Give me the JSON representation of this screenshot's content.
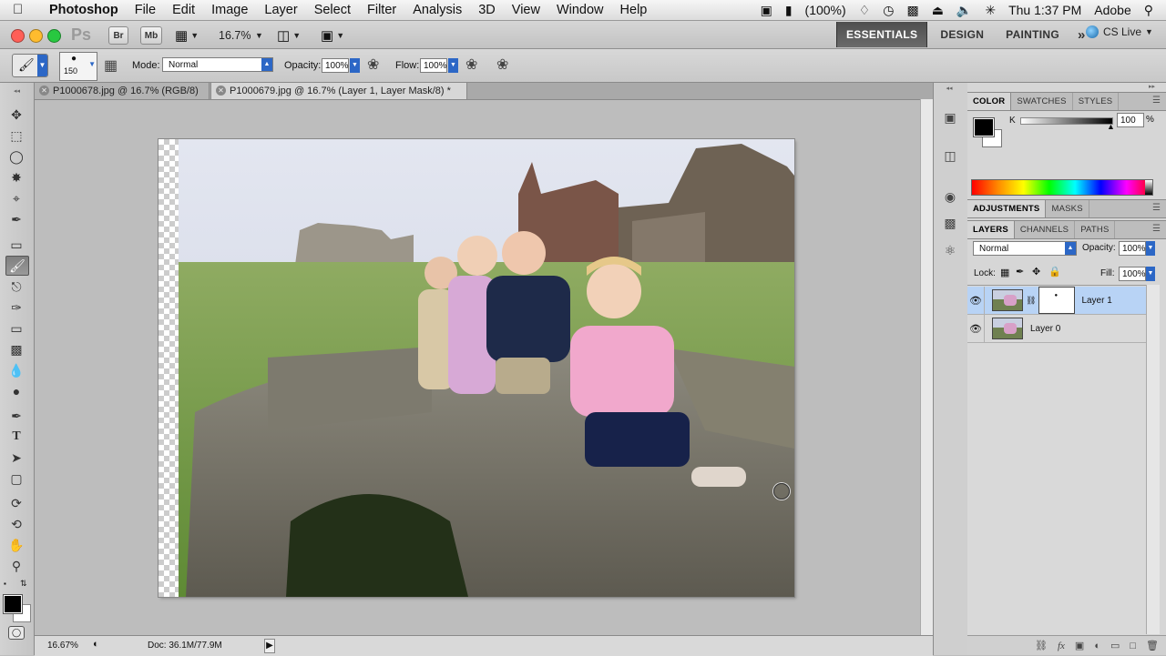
{
  "menubar": {
    "apple": "",
    "items": [
      "Photoshop",
      "File",
      "Edit",
      "Image",
      "Layer",
      "Select",
      "Filter",
      "Analysis",
      "3D",
      "View",
      "Window",
      "Help"
    ],
    "battery": "(100%)",
    "clock": "Thu 1:37 PM",
    "user": "Adobe"
  },
  "appbar": {
    "logo": "Ps",
    "bridge": "Br",
    "minibridge": "Mb",
    "zoom": "16.7%",
    "workspaces": [
      "ESSENTIALS",
      "DESIGN",
      "PAINTING"
    ],
    "more": "»",
    "cslive": "CS Live"
  },
  "options": {
    "brush_size": "150",
    "mode_label": "Mode:",
    "mode_value": "Normal",
    "opacity_label": "Opacity:",
    "opacity_value": "100%",
    "flow_label": "Flow:",
    "flow_value": "100%"
  },
  "tabs": [
    {
      "label": "P1000678.jpg @ 16.7% (RGB/8)"
    },
    {
      "label": "P1000679.jpg @ 16.7% (Layer 1, Layer Mask/8) *"
    }
  ],
  "status": {
    "zoom": "16.67%",
    "doc": "Doc: 36.1M/77.9M"
  },
  "color_panel": {
    "tabs": [
      "COLOR",
      "SWATCHES",
      "STYLES"
    ],
    "channel": "K",
    "value": "100",
    "unit": "%"
  },
  "adjust_panel": {
    "tabs": [
      "ADJUSTMENTS",
      "MASKS"
    ]
  },
  "layers_panel": {
    "tabs": [
      "LAYERS",
      "CHANNELS",
      "PATHS"
    ],
    "blend_mode": "Normal",
    "opacity_label": "Opacity:",
    "opacity_value": "100%",
    "lock_label": "Lock:",
    "fill_label": "Fill:",
    "fill_value": "100%",
    "layers": [
      {
        "name": "Layer 1",
        "selected": true,
        "has_mask": true
      },
      {
        "name": "Layer 0",
        "selected": false,
        "has_mask": false
      }
    ]
  },
  "colors": {
    "accent_blue": "#2c67c6",
    "selected_row": "#b8d3f5",
    "foreground": "#000000",
    "background": "#ffffff"
  }
}
